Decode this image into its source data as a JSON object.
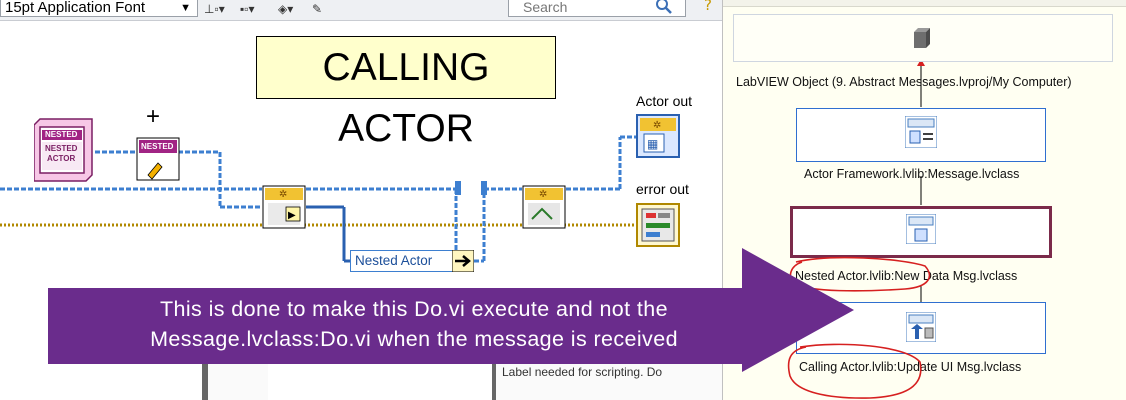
{
  "toolbar": {
    "font_selector": "15pt Application Font",
    "search_placeholder": "Search"
  },
  "diagram": {
    "title": "CALLING ACTOR",
    "actor_out_label": "Actor out",
    "error_out_label": "error out",
    "nested_actor_label": "Nested Actor",
    "nested_terminal_top": "NESTED",
    "nested_terminal_bottom": "NESTED",
    "nested_terminal_sub": "ACTOR",
    "nested_small_tag": "NESTED",
    "hidden_label_text": "Label needed for scripting. Do"
  },
  "hierarchy": {
    "nodes": [
      {
        "label": "LabVIEW Object (9. Abstract Messages.lvproj/My Computer)"
      },
      {
        "label": "Actor Framework.lvlib:Message.lvclass"
      },
      {
        "label": "Nested Actor.lvlib:New Data Msg.lvclass"
      },
      {
        "label": "Calling Actor.lvlib:Update UI Msg.lvclass"
      }
    ]
  },
  "callout": {
    "line1": "This is done to make this Do.vi execute and not the",
    "line2": "Message.lvclass:Do.vi when the message is received"
  },
  "colors": {
    "callout_purple": "#6a2c8c",
    "wire_blue": "#3d7fd0",
    "wire_gold": "#c8a000",
    "selected_border": "#7b2a4a",
    "annotation_red": "#d62020"
  }
}
